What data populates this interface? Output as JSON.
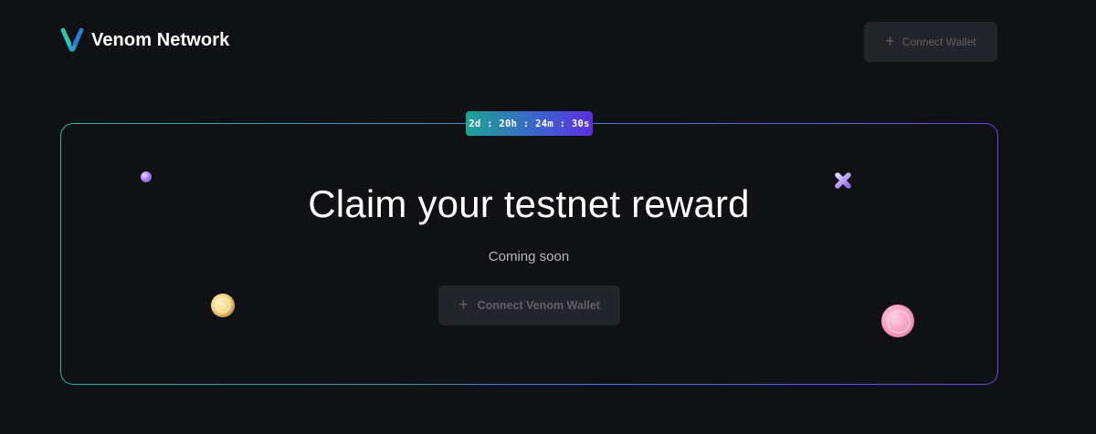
{
  "header": {
    "brand": "Venom Network",
    "connect_label": "Connect Wallet"
  },
  "card": {
    "countdown": "2d : 20h : 24m : 30s",
    "title": "Claim your testnet reward",
    "subtitle": "Coming soon",
    "connect_label": "Connect Venom Wallet"
  },
  "icons": {
    "logo": "venom-logo-icon",
    "plus": "plus-icon",
    "decorations": [
      "purple-orb-icon",
      "gold-coin-icon",
      "purple-x-icon",
      "pink-coin-icon"
    ]
  },
  "colors": {
    "background": "#101115",
    "button_bg": "#24252a",
    "accent_teal": "#2bb6a6",
    "accent_purple": "#6a46e0",
    "muted_text": "#5f6066"
  }
}
